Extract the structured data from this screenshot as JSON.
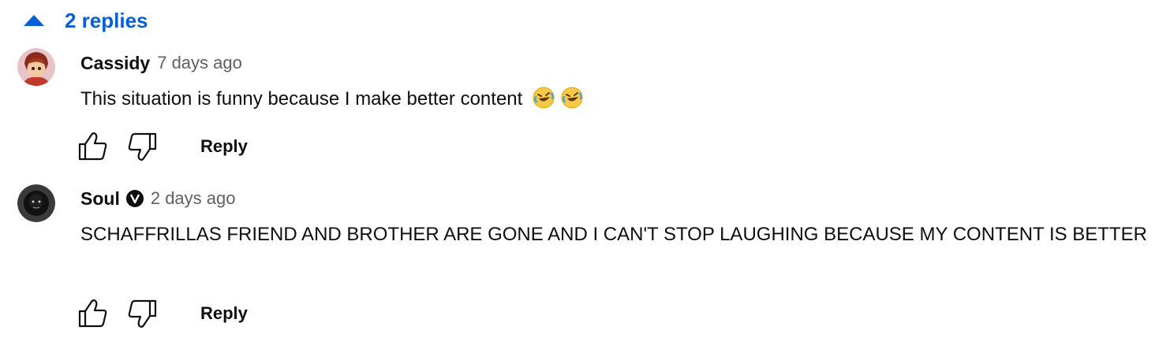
{
  "thread": {
    "replies_label": "2 replies"
  },
  "comments": [
    {
      "author": "Cassidy",
      "verified": false,
      "time": "7 days ago",
      "text": "This situation is funny because I make better content",
      "emoji": [
        "rolling-on-floor-laughing",
        "rolling-on-floor-laughing"
      ],
      "reply_label": "Reply"
    },
    {
      "author": "Soul",
      "verified": true,
      "time": "2 days ago",
      "text": "SCHAFFRILLAS FRIEND AND BROTHER ARE GONE AND I CAN'T STOP LAUGHING BECAUSE MY CONTENT IS BETTER",
      "reply_label": "Reply"
    }
  ],
  "colors": {
    "link": "#065fd4",
    "text": "#0f0f0f",
    "secondary": "#606060"
  },
  "icons": [
    "caret-up-icon",
    "thumbs-up-icon",
    "thumbs-down-icon",
    "verified-badge-icon",
    "laughing-emoji-icon"
  ]
}
